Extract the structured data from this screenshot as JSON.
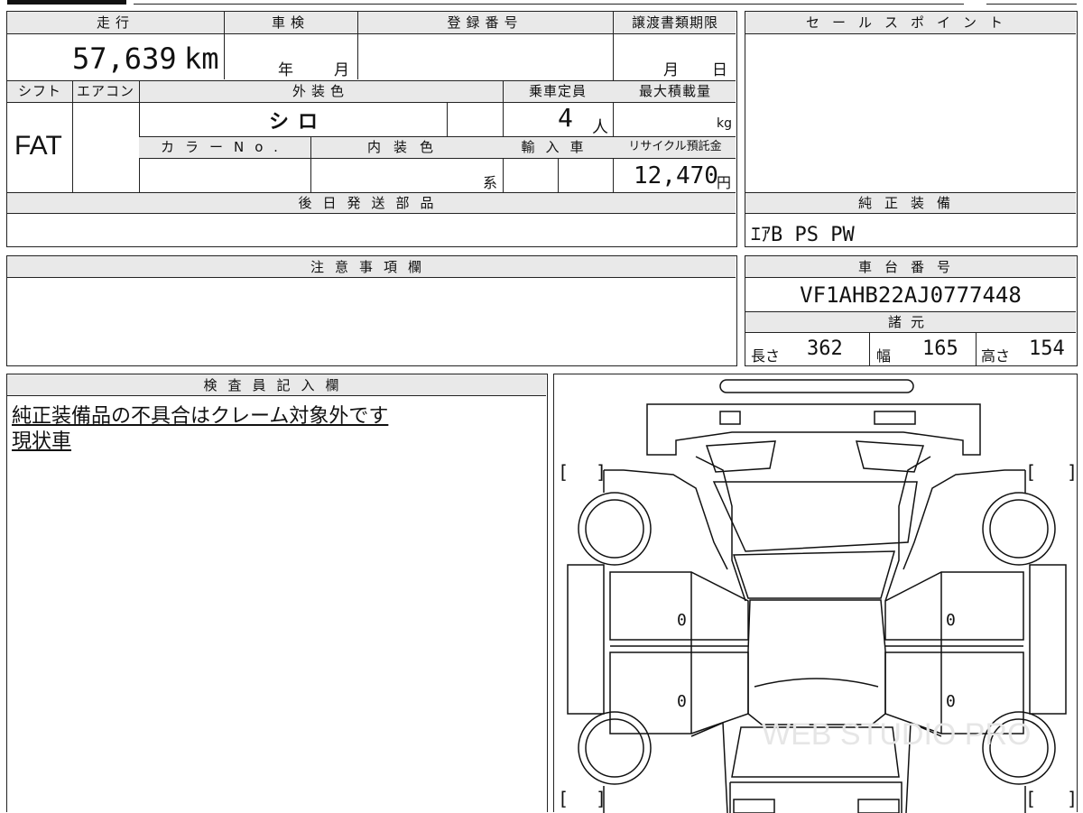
{
  "top_table": {
    "mileage": {
      "label": "走行",
      "value": "57,639",
      "unit": "km"
    },
    "inspection": {
      "label": "車検",
      "year_unit": "年",
      "month_unit": "月"
    },
    "registration": {
      "label": "登録番号"
    },
    "transfer_deadline": {
      "label": "譲渡書類期限",
      "month_unit": "月",
      "day_unit": "日"
    },
    "shift": {
      "label": "シフト",
      "value": "FAT"
    },
    "aircon": {
      "label": "エアコン"
    },
    "exterior_color": {
      "label": "外装色",
      "value": "シロ"
    },
    "capacity": {
      "label": "乗車定員",
      "value": "4",
      "unit": "人"
    },
    "max_load": {
      "label": "最大積載量",
      "unit": "kg"
    },
    "color_no": {
      "label": "カラーNo."
    },
    "interior_color": {
      "label": "内装色",
      "unit": "系"
    },
    "import": {
      "label": "輸入車"
    },
    "recycle_fee": {
      "label": "リサイクル預託金",
      "value": "12,470",
      "unit": "円"
    },
    "later_parts": {
      "label": "後日発送部品"
    }
  },
  "sales_point": {
    "label": "セールスポイント"
  },
  "genuine_equipment": {
    "label": "純正装備",
    "value": "ｴｱB PS PW"
  },
  "caution": {
    "label": "注意事項欄"
  },
  "chassis": {
    "label": "車台番号",
    "value": "VF1AHB22AJ0777448"
  },
  "specs": {
    "label": "諸元",
    "length_label": "長さ",
    "length": "362",
    "width_label": "幅",
    "width": "165",
    "height_label": "高さ",
    "height": "154"
  },
  "inspector": {
    "label": "検査員記入欄",
    "notes": [
      "純正装備品の不具合はクレーム対象外です",
      "現状車"
    ]
  },
  "diagram": {
    "bracket_left": "[",
    "bracket_right": "]",
    "marks": [
      "0",
      "0",
      "0",
      "0"
    ],
    "watermark": "WEB STUDIO PRO"
  }
}
